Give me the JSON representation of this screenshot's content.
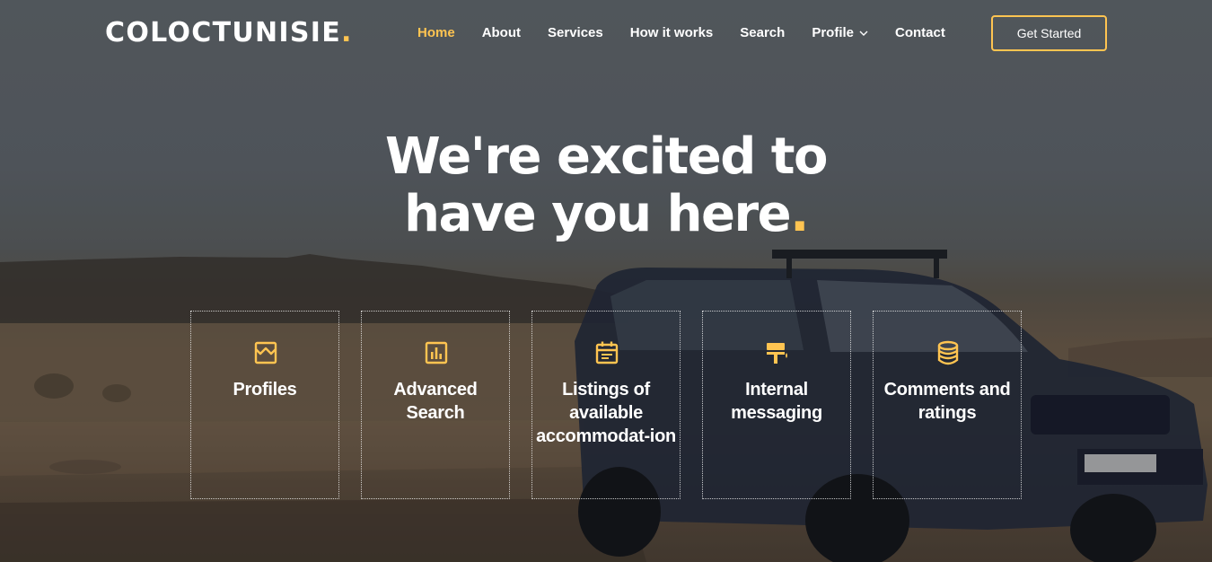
{
  "brand": {
    "name": "COLOCTUNISIE",
    "dot": ".",
    "accent": "#ffc451"
  },
  "nav": {
    "items": [
      {
        "label": "Home",
        "active": true
      },
      {
        "label": "About"
      },
      {
        "label": "Services"
      },
      {
        "label": "How it works"
      },
      {
        "label": "Search"
      },
      {
        "label": "Profile",
        "dropdown": true
      },
      {
        "label": "Contact"
      }
    ],
    "cta": "Get Started"
  },
  "hero": {
    "line1": "We're excited to",
    "line2": "have you here",
    "dot": "."
  },
  "features": [
    {
      "label": "Profiles",
      "icon": "store-icon"
    },
    {
      "label": "Advanced Search",
      "icon": "bar-chart-icon"
    },
    {
      "label": "Listings of available accommodat-ion",
      "icon": "calendar-icon"
    },
    {
      "label": "Internal messaging",
      "icon": "paint-roller-icon"
    },
    {
      "label": "Comments and ratings",
      "icon": "database-icon"
    }
  ]
}
